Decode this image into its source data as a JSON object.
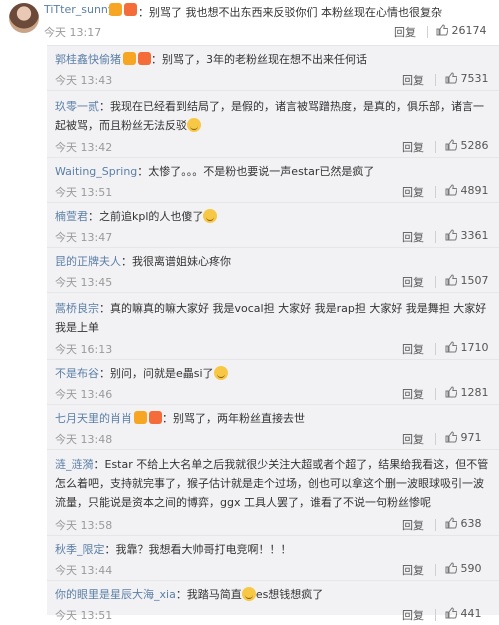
{
  "top_comment": {
    "username": "TiTter_sunny",
    "text": "：别骂了 我也想不出东西来反驳你们 本粉丝现在心情也很复杂",
    "time": "今天 13:17",
    "reply": "回复",
    "likes": "26174"
  },
  "replies": [
    {
      "username": "郭桂鑫快偷猪",
      "text": "：别骂了，3年的老粉丝现在想不出来任何话",
      "time": "今天 13:43",
      "reply": "回复",
      "likes": "7531"
    },
    {
      "username": "玖零一贰",
      "text": "：我现在已经看到结局了，是假的，诸言被骂蹭热度，是真的，俱乐部，诸言一起被骂，而且粉丝无法反驳",
      "time": "今天 13:42",
      "reply": "回复",
      "likes": "5286"
    },
    {
      "username": "Waiting_Spring",
      "text": "：太惨了。。。不是粉也要说一声estar已然是疯了",
      "time": "今天 13:51",
      "reply": "回复",
      "likes": "4891"
    },
    {
      "username": "楠萱君",
      "text": "：之前追kpl的人也傻了",
      "time": "今天 13:47",
      "reply": "回复",
      "likes": "3361"
    },
    {
      "username": "昆的正牌夫人",
      "text": "：我很离谱姐妹心疼你",
      "time": "今天 13:45",
      "reply": "回复",
      "likes": "1507"
    },
    {
      "username": "蒿桥良宗",
      "text": "：真的嘛真的嘛大家好 我是vocal担 大家好 我是rap担 大家好 我是舞担 大家好 我是上单",
      "time": "今天 16:13",
      "reply": "回复",
      "likes": "1710"
    },
    {
      "username": "不是布谷",
      "text": "：别问，问就是e畾si了",
      "time": "今天 13:46",
      "reply": "回复",
      "likes": "1281"
    },
    {
      "username": "七月天里的肖肖",
      "text": "：别骂了，两年粉丝直接去世",
      "time": "今天 13:48",
      "reply": "回复",
      "likes": "971"
    },
    {
      "username": "涟_涟漪",
      "text": "：Estar 不给上大名单之后我就很少关注大超或者个超了，结果给我看这，但不管怎么着吧，支持就完事了，猴子估计就是走个过场，创也可以拿这个删一波眼球吸引一波流量，只能说是资本之间的博弈，ggx 工具人罢了，谁看了不说一句粉丝惨呢",
      "time": "今天 13:58",
      "reply": "回复",
      "likes": "638"
    },
    {
      "username": "秋季_限定",
      "text": "：我靠？我想看大帅哥打电竞啊！！！",
      "time": "今天 13:44",
      "reply": "回复",
      "likes": "590"
    },
    {
      "username": "你的眼里是星辰大海_xia",
      "text": "：我踏马简直",
      "text2": "es想钱想疯了",
      "time": "今天 13:51",
      "reply": "回复",
      "likes": "441"
    }
  ],
  "colors": {
    "username": "#5b7fa6",
    "background": "#f2f2f5",
    "meta": "#9a9a9a"
  }
}
